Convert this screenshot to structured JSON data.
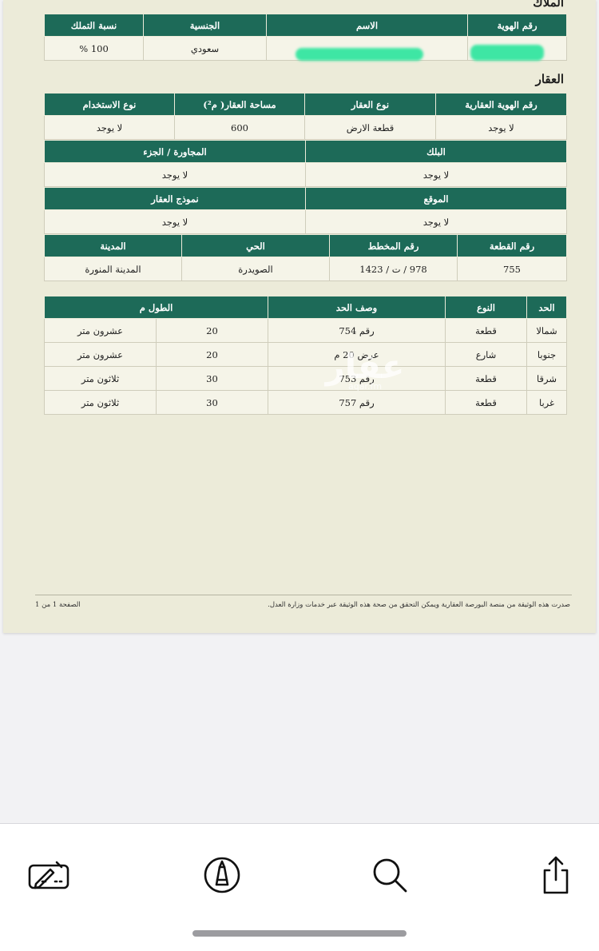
{
  "owners": {
    "section_title": "الملاك",
    "headers": [
      "رقم الهوية",
      "الاسم",
      "الجنسية",
      "نسبة التملك"
    ],
    "row": {
      "nationality": "سعودي",
      "ownership": "100 %"
    }
  },
  "property": {
    "section_title": "العقار",
    "table1": {
      "headers": [
        "رقم الهوية العقارية",
        "نوع العقار",
        "مساحة العقار( م²)",
        "نوع الاستخدام"
      ],
      "values": [
        "لا يوجد",
        "قطعة الارض",
        "600",
        "لا يوجد"
      ]
    },
    "block": {
      "headers": [
        "البلك",
        "المجاورة / الجزء"
      ],
      "values": [
        "لا يوجد",
        "لا يوجد"
      ]
    },
    "location": {
      "headers": [
        "الموقع",
        "نموذج العقار"
      ],
      "values": [
        "لا يوجد",
        "لا يوجد"
      ]
    },
    "plot": {
      "headers": [
        "رقم القطعة",
        "رقم المخطط",
        "الحي",
        "المدينة"
      ],
      "values": [
        "755",
        "978 / ت / 1423",
        "الصويدرة",
        "المدينة المنورة"
      ]
    }
  },
  "boundaries": {
    "headers": [
      "الحد",
      "النوع",
      "وصف الحد",
      "الطول م"
    ],
    "rows": [
      {
        "side": "شمالا",
        "type": "قطعة",
        "desc": "رقم 754",
        "len": "20",
        "len_text": "عشرون متر"
      },
      {
        "side": "جنوبا",
        "type": "شارع",
        "desc": "عرض 20 م",
        "len": "20",
        "len_text": "عشرون متر"
      },
      {
        "side": "شرقا",
        "type": "قطعة",
        "desc": "رقم 753",
        "len": "30",
        "len_text": "ثلاثون متر"
      },
      {
        "side": "غربا",
        "type": "قطعة",
        "desc": "رقم 757",
        "len": "30",
        "len_text": "ثلاثون متر"
      }
    ]
  },
  "watermark": {
    "big": "عقار",
    "small": "aqar.fm"
  },
  "footer": {
    "notice": "صدرت هذه الوثيقة من منصة البورصة العقارية ويمكن التحقق من صحة هذه الوثيقة عبر خدمات وزارة العدل.",
    "page": "الصفحة 1 من 1"
  },
  "toolbar": {
    "icons": [
      "keyboard-edit-icon",
      "markup-pen-icon",
      "search-icon",
      "share-icon"
    ]
  },
  "colors": {
    "header_green": "#1d6a58",
    "paper": "#ecebd9",
    "redaction": "#3ee6a4"
  }
}
